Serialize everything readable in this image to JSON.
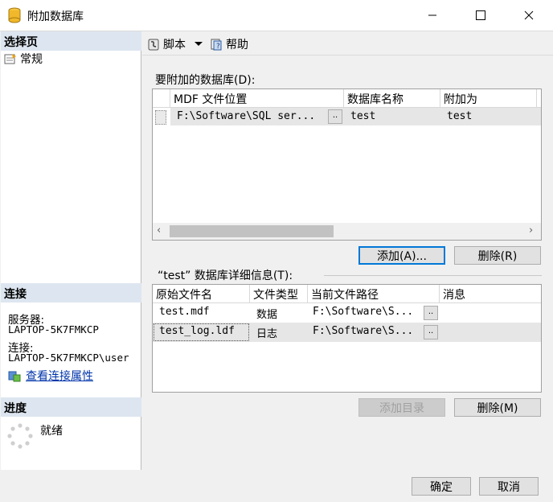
{
  "window": {
    "title": "附加数据库"
  },
  "sidebar": {
    "select_page_header": "选择页",
    "pages": [
      {
        "label": "常规",
        "icon": "general-page-icon"
      }
    ],
    "connection_header": "连接",
    "server_label": "服务器:",
    "server_value": "LAPTOP-5K7FMKCP",
    "connection_label": "连接:",
    "connection_value": "LAPTOP-5K7FMKCP\\user",
    "view_connection_link": "查看连接属性",
    "progress_header": "进度",
    "progress_status": "就绪"
  },
  "toolbar": {
    "script_label": "脚本",
    "help_label": "帮助"
  },
  "attach": {
    "section_label": "要附加的数据库(D):",
    "columns": [
      "MDF 文件位置",
      "数据库名称",
      "附加为",
      ""
    ],
    "rows": [
      {
        "mdf_location": "F:\\Software\\SQL ser...",
        "db_name": "test",
        "attach_as": "test",
        "browse": ".."
      }
    ],
    "add_button": "添加(A)...",
    "remove_button": "删除(R)"
  },
  "details": {
    "section_label": "“test” 数据库详细信息(T):",
    "columns": [
      "原始文件名",
      "文件类型",
      "当前文件路径",
      "消息"
    ],
    "rows": [
      {
        "file_name": "test.mdf",
        "file_type": "数据",
        "current_path": "F:\\Software\\S...",
        "browse": "..",
        "message": ""
      },
      {
        "file_name": "test_log.ldf",
        "file_type": "日志",
        "current_path": "F:\\Software\\S...",
        "browse": "..",
        "message": ""
      }
    ],
    "add_catalog_button": "添加目录",
    "remove_button": "删除(M)"
  },
  "footer": {
    "ok_button": "确定",
    "cancel_button": "取消"
  }
}
